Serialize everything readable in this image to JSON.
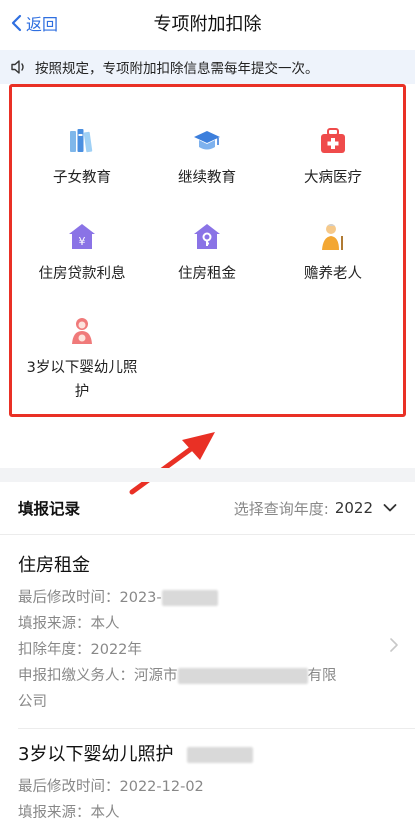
{
  "nav": {
    "back_label": "返回",
    "title": "专项附加扣除"
  },
  "notice": {
    "text": "按照规定，专项附加扣除信息需每年提交一次。"
  },
  "categories": [
    {
      "label": "子女教育",
      "icon": "books-icon"
    },
    {
      "label": "继续教育",
      "icon": "graduation-cap-icon"
    },
    {
      "label": "大病医疗",
      "icon": "medical-kit-icon"
    },
    {
      "label": "住房贷款利息",
      "icon": "house-yuan-icon"
    },
    {
      "label": "住房租金",
      "icon": "house-key-icon"
    },
    {
      "label": "赡养老人",
      "icon": "elderly-person-icon"
    },
    {
      "label": "3岁以下婴幼儿照护",
      "icon": "baby-care-icon"
    }
  ],
  "records": {
    "title": "填报记录",
    "year_label": "选择查询年度:",
    "year_value": "2022",
    "items": [
      {
        "title": "住房租金",
        "modified_label": "最后修改时间：",
        "modified_value": "2023-",
        "source": "填报来源：本人",
        "year": "扣除年度：2022年",
        "agent_prefix": "申报扣缴义务人：河源市",
        "agent_suffix": "有限",
        "agent_line2": "公司"
      },
      {
        "title": "3岁以下婴幼儿照护",
        "modified_label": "最后修改时间：",
        "modified_value": "2022-12-02",
        "source": "填报来源：本人"
      }
    ]
  },
  "colors": {
    "accent": "#2f6fe0",
    "highlight": "#e93025",
    "icon_purple": "#8a73e6",
    "icon_orange": "#f3a733",
    "icon_red": "#ef4b4b"
  }
}
